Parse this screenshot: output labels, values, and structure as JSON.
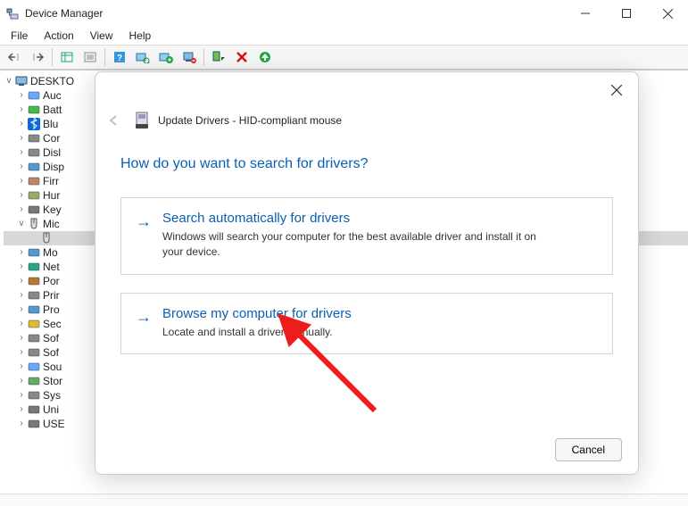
{
  "window": {
    "title": "Device Manager"
  },
  "menu": {
    "items": [
      "File",
      "Action",
      "View",
      "Help"
    ]
  },
  "tree": {
    "root": "DESKTO",
    "items": [
      {
        "label": "Auc",
        "tw": ">",
        "icon": "audio"
      },
      {
        "label": "Batt",
        "tw": ">",
        "icon": "battery"
      },
      {
        "label": "Blu",
        "tw": ">",
        "icon": "bluetooth"
      },
      {
        "label": "Cor",
        "tw": ">",
        "icon": "computer"
      },
      {
        "label": "Disl",
        "tw": ">",
        "icon": "disk"
      },
      {
        "label": "Disp",
        "tw": ">",
        "icon": "display"
      },
      {
        "label": "Firr",
        "tw": ">",
        "icon": "firmware"
      },
      {
        "label": "Hur",
        "tw": ">",
        "icon": "hid"
      },
      {
        "label": "Key",
        "tw": ">",
        "icon": "keyboard"
      },
      {
        "label": "Mic",
        "tw": "v",
        "icon": "mouse"
      },
      {
        "label": "",
        "tw": "",
        "icon": "mouse-sel",
        "sel": true,
        "ind": 2
      },
      {
        "label": "Mo",
        "tw": ">",
        "icon": "monitor"
      },
      {
        "label": "Net",
        "tw": ">",
        "icon": "network"
      },
      {
        "label": "Por",
        "tw": ">",
        "icon": "port"
      },
      {
        "label": "Prir",
        "tw": ">",
        "icon": "printer"
      },
      {
        "label": "Pro",
        "tw": ">",
        "icon": "processor"
      },
      {
        "label": "Sec",
        "tw": ">",
        "icon": "security"
      },
      {
        "label": "Sof",
        "tw": ">",
        "icon": "software"
      },
      {
        "label": "Sof",
        "tw": ">",
        "icon": "software"
      },
      {
        "label": "Sou",
        "tw": ">",
        "icon": "sound"
      },
      {
        "label": "Stor",
        "tw": ">",
        "icon": "storage"
      },
      {
        "label": "Sys",
        "tw": ">",
        "icon": "system"
      },
      {
        "label": "Uni",
        "tw": ">",
        "icon": "usb"
      },
      {
        "label": "USE",
        "tw": ">",
        "icon": "usb"
      }
    ]
  },
  "dialog": {
    "title": "Update Drivers - HID-compliant mouse",
    "question": "How do you want to search for drivers?",
    "opts": [
      {
        "title": "Search automatically for drivers",
        "desc": "Windows will search your computer for the best available driver and install it on your device."
      },
      {
        "title": "Browse my computer for drivers",
        "desc": "Locate and install a driver manually."
      }
    ],
    "cancel": "Cancel"
  }
}
